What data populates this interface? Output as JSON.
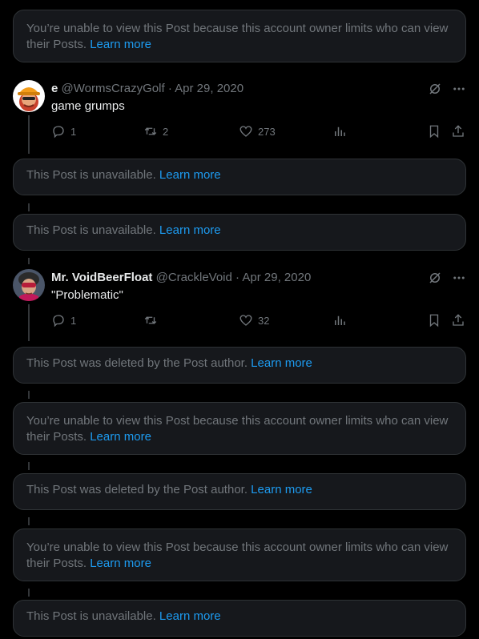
{
  "notices": {
    "limited_text": "You’re unable to view this Post because this account owner limits who can view their Posts.",
    "unavailable_text": "This Post is unavailable.",
    "deleted_text": "This Post was deleted by the Post author.",
    "learn_more": "Learn more"
  },
  "tweet1": {
    "name": "e",
    "handle": "@WormsCrazyGolf",
    "dot": "·",
    "date": "Apr 29, 2020",
    "text": "game grumps",
    "replies": "1",
    "retweets": "2",
    "likes": "273"
  },
  "tweet2": {
    "name": "Mr. VoidBeerFloat",
    "handle": "@CrackleVoid",
    "dot": "·",
    "date": "Apr 29, 2020",
    "text": "\"Problematic\"",
    "replies": "1",
    "retweets": "",
    "likes": "32"
  },
  "icons": {
    "grok": "grok-icon",
    "more": "more-icon",
    "reply": "reply-icon",
    "retweet": "retweet-icon",
    "like": "heart-icon",
    "views": "views-icon",
    "bookmark": "bookmark-icon",
    "share": "share-icon"
  },
  "colors": {
    "background": "#000000",
    "card": "#16181c",
    "muted": "#71767b",
    "link": "#1d9bf0"
  }
}
